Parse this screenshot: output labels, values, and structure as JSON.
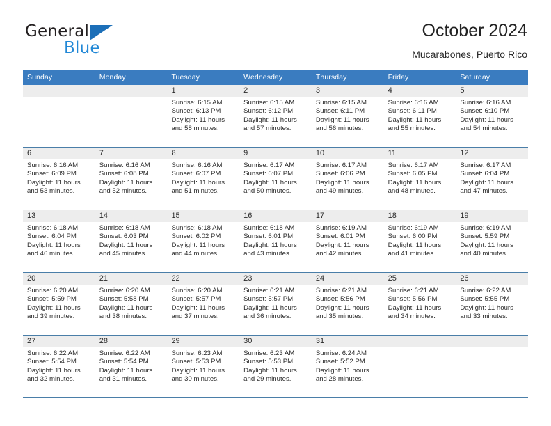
{
  "logo": {
    "word_top": "General",
    "word_bottom": "Blue",
    "triangle_color": "#1c6fb8",
    "bottom_color": "#2288d6"
  },
  "header": {
    "title": "October 2024",
    "location": "Mucarabones, Puerto Rico"
  },
  "theme": {
    "header_blue": "#3a7cc0",
    "row_divider": "#4a7ea8",
    "daynum_band": "#ededed",
    "text": "#2b2b2b"
  },
  "calendar": {
    "weekdays": [
      "Sunday",
      "Monday",
      "Tuesday",
      "Wednesday",
      "Thursday",
      "Friday",
      "Saturday"
    ],
    "weeks": [
      [
        {
          "day": "",
          "sunrise": "",
          "sunset": "",
          "daylight1": "",
          "daylight2": ""
        },
        {
          "day": "",
          "sunrise": "",
          "sunset": "",
          "daylight1": "",
          "daylight2": ""
        },
        {
          "day": "1",
          "sunrise": "Sunrise: 6:15 AM",
          "sunset": "Sunset: 6:13 PM",
          "daylight1": "Daylight: 11 hours",
          "daylight2": "and 58 minutes."
        },
        {
          "day": "2",
          "sunrise": "Sunrise: 6:15 AM",
          "sunset": "Sunset: 6:12 PM",
          "daylight1": "Daylight: 11 hours",
          "daylight2": "and 57 minutes."
        },
        {
          "day": "3",
          "sunrise": "Sunrise: 6:15 AM",
          "sunset": "Sunset: 6:11 PM",
          "daylight1": "Daylight: 11 hours",
          "daylight2": "and 56 minutes."
        },
        {
          "day": "4",
          "sunrise": "Sunrise: 6:16 AM",
          "sunset": "Sunset: 6:11 PM",
          "daylight1": "Daylight: 11 hours",
          "daylight2": "and 55 minutes."
        },
        {
          "day": "5",
          "sunrise": "Sunrise: 6:16 AM",
          "sunset": "Sunset: 6:10 PM",
          "daylight1": "Daylight: 11 hours",
          "daylight2": "and 54 minutes."
        }
      ],
      [
        {
          "day": "6",
          "sunrise": "Sunrise: 6:16 AM",
          "sunset": "Sunset: 6:09 PM",
          "daylight1": "Daylight: 11 hours",
          "daylight2": "and 53 minutes."
        },
        {
          "day": "7",
          "sunrise": "Sunrise: 6:16 AM",
          "sunset": "Sunset: 6:08 PM",
          "daylight1": "Daylight: 11 hours",
          "daylight2": "and 52 minutes."
        },
        {
          "day": "8",
          "sunrise": "Sunrise: 6:16 AM",
          "sunset": "Sunset: 6:07 PM",
          "daylight1": "Daylight: 11 hours",
          "daylight2": "and 51 minutes."
        },
        {
          "day": "9",
          "sunrise": "Sunrise: 6:17 AM",
          "sunset": "Sunset: 6:07 PM",
          "daylight1": "Daylight: 11 hours",
          "daylight2": "and 50 minutes."
        },
        {
          "day": "10",
          "sunrise": "Sunrise: 6:17 AM",
          "sunset": "Sunset: 6:06 PM",
          "daylight1": "Daylight: 11 hours",
          "daylight2": "and 49 minutes."
        },
        {
          "day": "11",
          "sunrise": "Sunrise: 6:17 AM",
          "sunset": "Sunset: 6:05 PM",
          "daylight1": "Daylight: 11 hours",
          "daylight2": "and 48 minutes."
        },
        {
          "day": "12",
          "sunrise": "Sunrise: 6:17 AM",
          "sunset": "Sunset: 6:04 PM",
          "daylight1": "Daylight: 11 hours",
          "daylight2": "and 47 minutes."
        }
      ],
      [
        {
          "day": "13",
          "sunrise": "Sunrise: 6:18 AM",
          "sunset": "Sunset: 6:04 PM",
          "daylight1": "Daylight: 11 hours",
          "daylight2": "and 46 minutes."
        },
        {
          "day": "14",
          "sunrise": "Sunrise: 6:18 AM",
          "sunset": "Sunset: 6:03 PM",
          "daylight1": "Daylight: 11 hours",
          "daylight2": "and 45 minutes."
        },
        {
          "day": "15",
          "sunrise": "Sunrise: 6:18 AM",
          "sunset": "Sunset: 6:02 PM",
          "daylight1": "Daylight: 11 hours",
          "daylight2": "and 44 minutes."
        },
        {
          "day": "16",
          "sunrise": "Sunrise: 6:18 AM",
          "sunset": "Sunset: 6:01 PM",
          "daylight1": "Daylight: 11 hours",
          "daylight2": "and 43 minutes."
        },
        {
          "day": "17",
          "sunrise": "Sunrise: 6:19 AM",
          "sunset": "Sunset: 6:01 PM",
          "daylight1": "Daylight: 11 hours",
          "daylight2": "and 42 minutes."
        },
        {
          "day": "18",
          "sunrise": "Sunrise: 6:19 AM",
          "sunset": "Sunset: 6:00 PM",
          "daylight1": "Daylight: 11 hours",
          "daylight2": "and 41 minutes."
        },
        {
          "day": "19",
          "sunrise": "Sunrise: 6:19 AM",
          "sunset": "Sunset: 5:59 PM",
          "daylight1": "Daylight: 11 hours",
          "daylight2": "and 40 minutes."
        }
      ],
      [
        {
          "day": "20",
          "sunrise": "Sunrise: 6:20 AM",
          "sunset": "Sunset: 5:59 PM",
          "daylight1": "Daylight: 11 hours",
          "daylight2": "and 39 minutes."
        },
        {
          "day": "21",
          "sunrise": "Sunrise: 6:20 AM",
          "sunset": "Sunset: 5:58 PM",
          "daylight1": "Daylight: 11 hours",
          "daylight2": "and 38 minutes."
        },
        {
          "day": "22",
          "sunrise": "Sunrise: 6:20 AM",
          "sunset": "Sunset: 5:57 PM",
          "daylight1": "Daylight: 11 hours",
          "daylight2": "and 37 minutes."
        },
        {
          "day": "23",
          "sunrise": "Sunrise: 6:21 AM",
          "sunset": "Sunset: 5:57 PM",
          "daylight1": "Daylight: 11 hours",
          "daylight2": "and 36 minutes."
        },
        {
          "day": "24",
          "sunrise": "Sunrise: 6:21 AM",
          "sunset": "Sunset: 5:56 PM",
          "daylight1": "Daylight: 11 hours",
          "daylight2": "and 35 minutes."
        },
        {
          "day": "25",
          "sunrise": "Sunrise: 6:21 AM",
          "sunset": "Sunset: 5:56 PM",
          "daylight1": "Daylight: 11 hours",
          "daylight2": "and 34 minutes."
        },
        {
          "day": "26",
          "sunrise": "Sunrise: 6:22 AM",
          "sunset": "Sunset: 5:55 PM",
          "daylight1": "Daylight: 11 hours",
          "daylight2": "and 33 minutes."
        }
      ],
      [
        {
          "day": "27",
          "sunrise": "Sunrise: 6:22 AM",
          "sunset": "Sunset: 5:54 PM",
          "daylight1": "Daylight: 11 hours",
          "daylight2": "and 32 minutes."
        },
        {
          "day": "28",
          "sunrise": "Sunrise: 6:22 AM",
          "sunset": "Sunset: 5:54 PM",
          "daylight1": "Daylight: 11 hours",
          "daylight2": "and 31 minutes."
        },
        {
          "day": "29",
          "sunrise": "Sunrise: 6:23 AM",
          "sunset": "Sunset: 5:53 PM",
          "daylight1": "Daylight: 11 hours",
          "daylight2": "and 30 minutes."
        },
        {
          "day": "30",
          "sunrise": "Sunrise: 6:23 AM",
          "sunset": "Sunset: 5:53 PM",
          "daylight1": "Daylight: 11 hours",
          "daylight2": "and 29 minutes."
        },
        {
          "day": "31",
          "sunrise": "Sunrise: 6:24 AM",
          "sunset": "Sunset: 5:52 PM",
          "daylight1": "Daylight: 11 hours",
          "daylight2": "and 28 minutes."
        },
        {
          "day": "",
          "sunrise": "",
          "sunset": "",
          "daylight1": "",
          "daylight2": ""
        },
        {
          "day": "",
          "sunrise": "",
          "sunset": "",
          "daylight1": "",
          "daylight2": ""
        }
      ]
    ]
  }
}
